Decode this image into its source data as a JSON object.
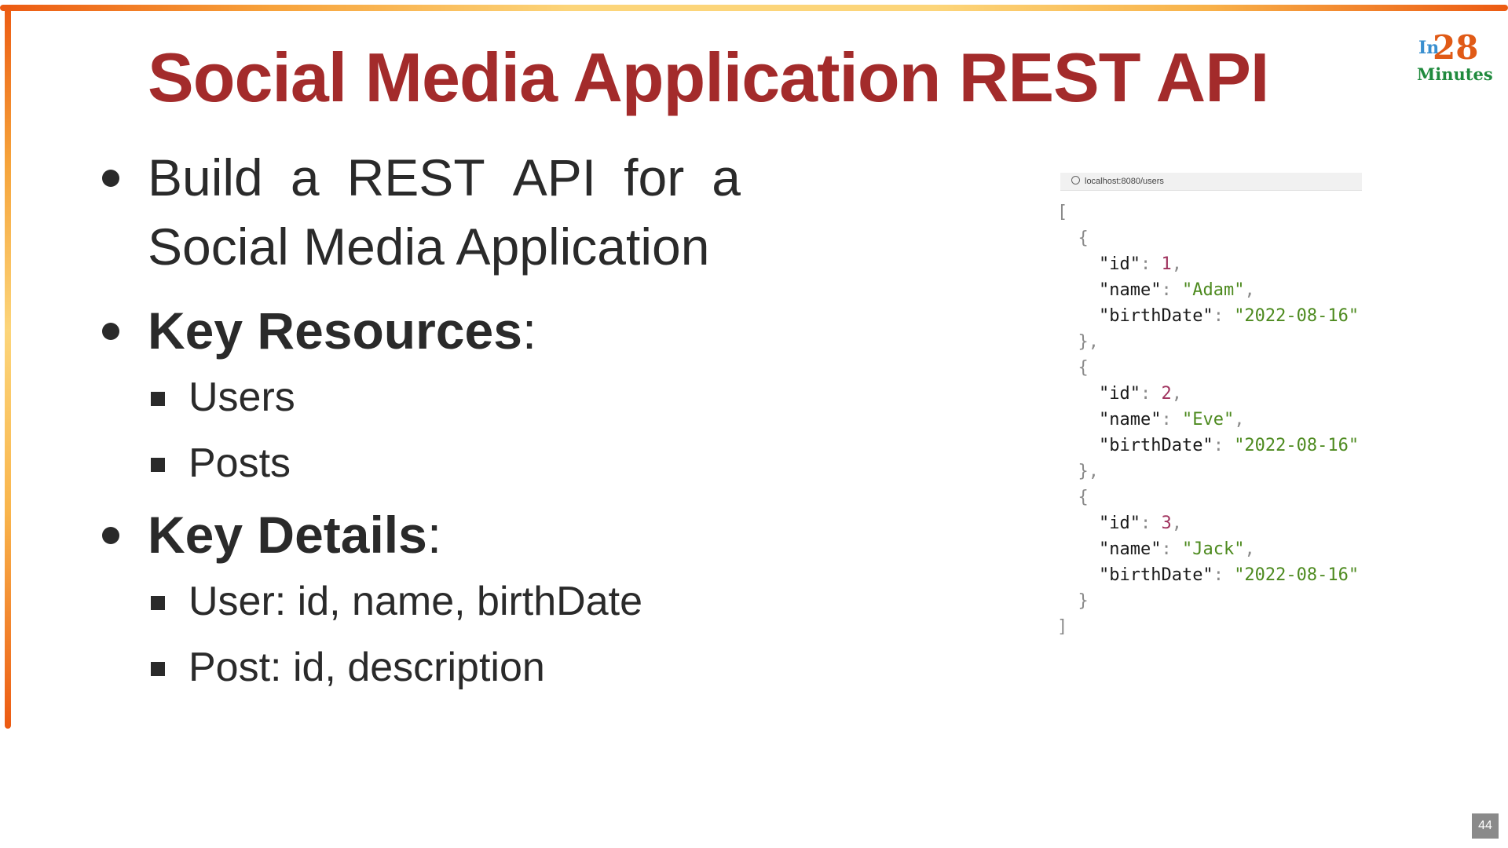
{
  "slide": {
    "title": "Social Media Application REST API",
    "logo": {
      "prefix": "In",
      "number": "28",
      "word": "Minutes"
    },
    "page_number": "44"
  },
  "bullets": {
    "b1_words": [
      "Build",
      "a",
      "REST",
      "API",
      "for",
      "a"
    ],
    "b1_line2": "Social Media Application",
    "b2_label": "Key Resources",
    "b2_suffix": ":",
    "b2_items": [
      "Users",
      "Posts"
    ],
    "b3_label": "Key Details",
    "b3_suffix": ":",
    "b3_items": [
      "User: id, name, birthDate",
      "Post: id, description"
    ]
  },
  "json_preview": {
    "url": "localhost:8080/users",
    "users": [
      {
        "id": "1",
        "name": "\"Adam\"",
        "birthDate": "\"2022-08-16\""
      },
      {
        "id": "2",
        "name": "\"Eve\"",
        "birthDate": "\"2022-08-16\""
      },
      {
        "id": "3",
        "name": "\"Jack\"",
        "birthDate": "\"2022-08-16\""
      }
    ],
    "keys": {
      "id": "\"id\"",
      "name": "\"name\"",
      "birthDate": "\"birthDate\""
    }
  },
  "colors": {
    "title": "#a32b2b",
    "frame_orange": "#ec5a12",
    "frame_yellow": "#fcd57a",
    "json_string": "#4d8a1f",
    "json_number": "#a0335e"
  }
}
